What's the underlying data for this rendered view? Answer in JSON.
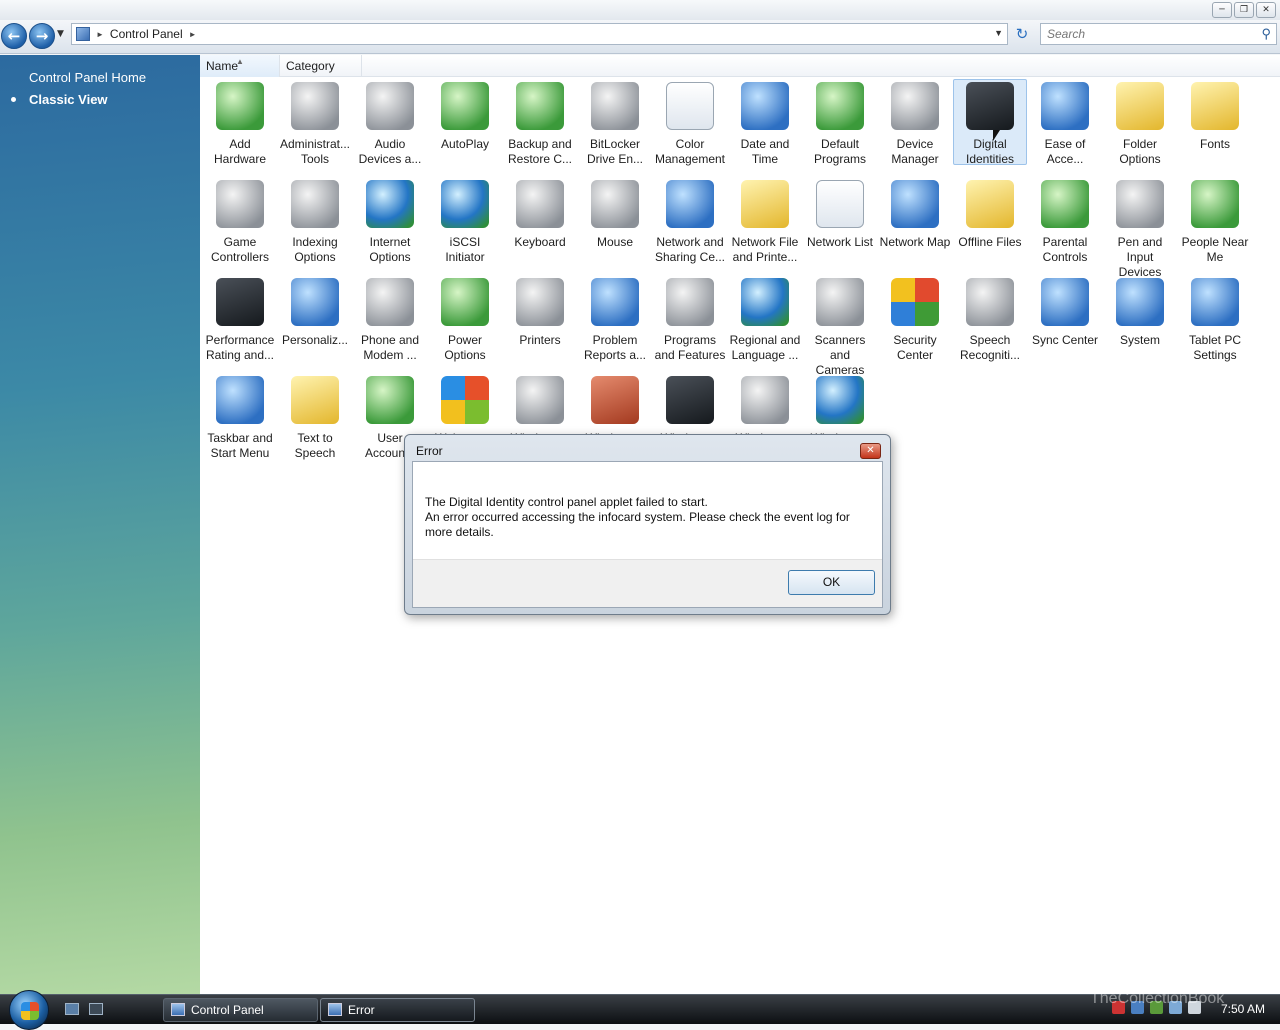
{
  "window": {
    "controls": [
      "minimize-icon",
      "maximize-icon",
      "close-icon"
    ]
  },
  "navbar": {
    "breadcrumb": "Control Panel",
    "search_placeholder": "Search"
  },
  "leftpane": {
    "home_link": "Control Panel Home",
    "classic_view": "Classic View"
  },
  "columns": {
    "name": "Name",
    "category": "Category"
  },
  "items": [
    {
      "label": "Add Hardware",
      "icon": "add-hardware-icon",
      "cls": "i-green"
    },
    {
      "label": "Administrat... Tools",
      "icon": "admin-tools-icon",
      "cls": "i-gray"
    },
    {
      "label": "Audio Devices a...",
      "icon": "speaker-icon",
      "cls": "i-gray"
    },
    {
      "label": "AutoPlay",
      "icon": "autoplay-icon",
      "cls": "i-green"
    },
    {
      "label": "Backup and Restore C...",
      "icon": "backup-icon",
      "cls": "i-green"
    },
    {
      "label": "BitLocker Drive En...",
      "icon": "bitlocker-icon",
      "cls": "i-gray"
    },
    {
      "label": "Color Management",
      "icon": "color-management-icon",
      "cls": "i-paper"
    },
    {
      "label": "Date and Time",
      "icon": "clock-icon",
      "cls": "i-blue"
    },
    {
      "label": "Default Programs",
      "icon": "default-programs-icon",
      "cls": "i-green"
    },
    {
      "label": "Device Manager",
      "icon": "device-manager-icon",
      "cls": "i-gray"
    },
    {
      "label": "Digital Identities",
      "icon": "digital-identities-icon",
      "cls": "i-dark",
      "selected": true
    },
    {
      "label": "Ease of Acce...",
      "icon": "ease-of-access-icon",
      "cls": "i-blue"
    },
    {
      "label": "Folder Options",
      "icon": "folder-icon",
      "cls": "i-yellow"
    },
    {
      "label": "Fonts",
      "icon": "fonts-folder-icon",
      "cls": "i-yellow"
    },
    {
      "label": "Game Controllers",
      "icon": "gamepad-icon",
      "cls": "i-gray"
    },
    {
      "label": "Indexing Options",
      "icon": "magnifier-icon",
      "cls": "i-gray"
    },
    {
      "label": "Internet Options",
      "icon": "internet-options-icon",
      "cls": "i-globe"
    },
    {
      "label": "iSCSI Initiator",
      "icon": "iscsi-icon",
      "cls": "i-globe"
    },
    {
      "label": "Keyboard",
      "icon": "keyboard-icon",
      "cls": "i-gray"
    },
    {
      "label": "Mouse",
      "icon": "mouse-icon",
      "cls": "i-gray"
    },
    {
      "label": "Network and Sharing Ce...",
      "icon": "network-sharing-icon",
      "cls": "i-blue"
    },
    {
      "label": "Network File and Printe...",
      "icon": "network-folder-icon",
      "cls": "i-yellow"
    },
    {
      "label": "Network List",
      "icon": "network-list-icon",
      "cls": "i-paper"
    },
    {
      "label": "Network Map",
      "icon": "network-map-icon",
      "cls": "i-blue"
    },
    {
      "label": "Offline Files",
      "icon": "offline-files-icon",
      "cls": "i-yellow"
    },
    {
      "label": "Parental Controls",
      "icon": "parental-controls-icon",
      "cls": "i-green"
    },
    {
      "label": "Pen and Input Devices",
      "icon": "pen-icon",
      "cls": "i-gray"
    },
    {
      "label": "People Near Me",
      "icon": "people-icon",
      "cls": "i-green"
    },
    {
      "label": "Performance Rating and...",
      "icon": "performance-icon",
      "cls": "i-dark"
    },
    {
      "label": "Personaliz...",
      "icon": "personalize-icon",
      "cls": "i-blue"
    },
    {
      "label": "Phone and Modem ...",
      "icon": "phone-modem-icon",
      "cls": "i-gray"
    },
    {
      "label": "Power Options",
      "icon": "power-icon",
      "cls": "i-green"
    },
    {
      "label": "Printers",
      "icon": "printer-icon",
      "cls": "i-gray"
    },
    {
      "label": "Problem Reports a...",
      "icon": "problem-reports-icon",
      "cls": "i-blue"
    },
    {
      "label": "Programs and Features",
      "icon": "programs-icon",
      "cls": "i-gray"
    },
    {
      "label": "Regional and Language ...",
      "icon": "regional-icon",
      "cls": "i-globe"
    },
    {
      "label": "Scanners and Cameras",
      "icon": "camera-icon",
      "cls": "i-gray"
    },
    {
      "label": "Security Center",
      "icon": "security-shield-icon",
      "cls": "i-shield"
    },
    {
      "label": "Speech Recogniti...",
      "icon": "microphone-icon",
      "cls": "i-gray"
    },
    {
      "label": "Sync Center",
      "icon": "sync-icon",
      "cls": "i-blue"
    },
    {
      "label": "System",
      "icon": "system-icon",
      "cls": "i-blue"
    },
    {
      "label": "Tablet PC Settings",
      "icon": "tablet-icon",
      "cls": "i-blue"
    },
    {
      "label": "Taskbar and Start Menu",
      "icon": "taskbar-icon",
      "cls": "i-blue"
    },
    {
      "label": "Text to Speech",
      "icon": "text-to-speech-icon",
      "cls": "i-yellow"
    },
    {
      "label": "User Accoun...",
      "icon": "user-accounts-icon",
      "cls": "i-green"
    },
    {
      "label": "Welcome...",
      "icon": "windows-logo-icon",
      "cls": "i-win"
    },
    {
      "label": "Windows...",
      "icon": "firewall-wall-icon",
      "cls": "i-gray"
    },
    {
      "label": "Windows...",
      "icon": "firewall-globe-icon",
      "cls": "i-red"
    },
    {
      "label": "Windows...",
      "icon": "mobility-center-icon",
      "cls": "i-dark"
    },
    {
      "label": "Windows...",
      "icon": "sideshow-icon",
      "cls": "i-gray"
    },
    {
      "label": "Windows...",
      "icon": "windows-update-icon",
      "cls": "i-globe"
    }
  ],
  "dialog": {
    "title": "Error",
    "line1": "The Digital Identity control panel applet failed to start.",
    "line2": "An error occurred accessing the infocard system. Please check the event log for more details.",
    "ok_label": "OK"
  },
  "taskbar": {
    "tasks": [
      {
        "label": "Control Panel"
      },
      {
        "label": "Error"
      }
    ],
    "clock": "7:50 AM"
  },
  "watermark": "TheCollectionBook"
}
